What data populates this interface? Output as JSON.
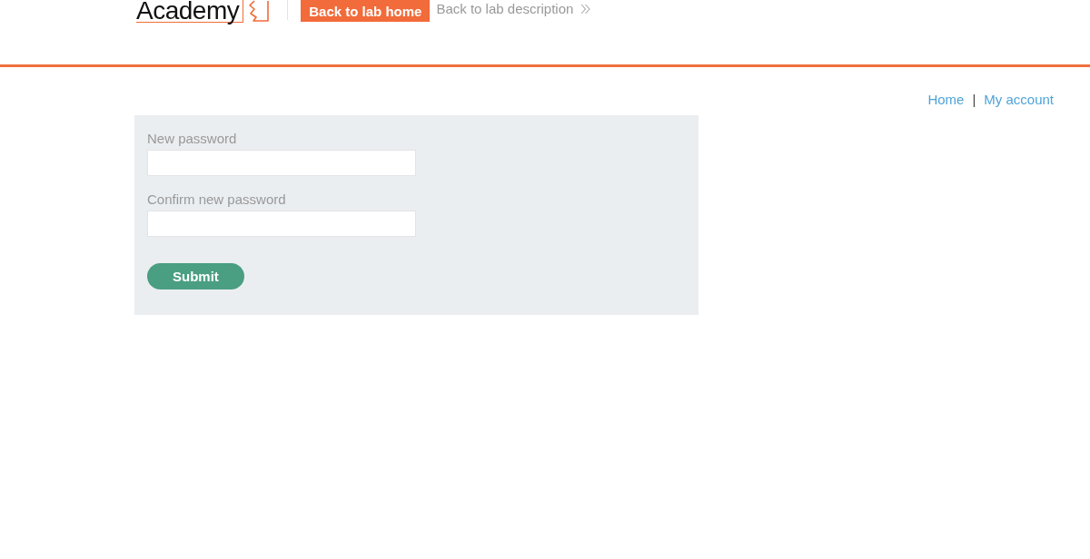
{
  "header": {
    "logo": {
      "text": "Academy"
    },
    "back_home_button": {
      "label": "Back to lab home"
    },
    "back_description_link": {
      "label": "Back to lab description"
    }
  },
  "nav": {
    "links": [
      {
        "label": "Home"
      },
      {
        "label": "My account"
      }
    ],
    "separator": "|"
  },
  "form": {
    "fields": [
      {
        "label": "New password"
      },
      {
        "label": "Confirm new password"
      }
    ],
    "submit": {
      "label": "Submit"
    }
  }
}
